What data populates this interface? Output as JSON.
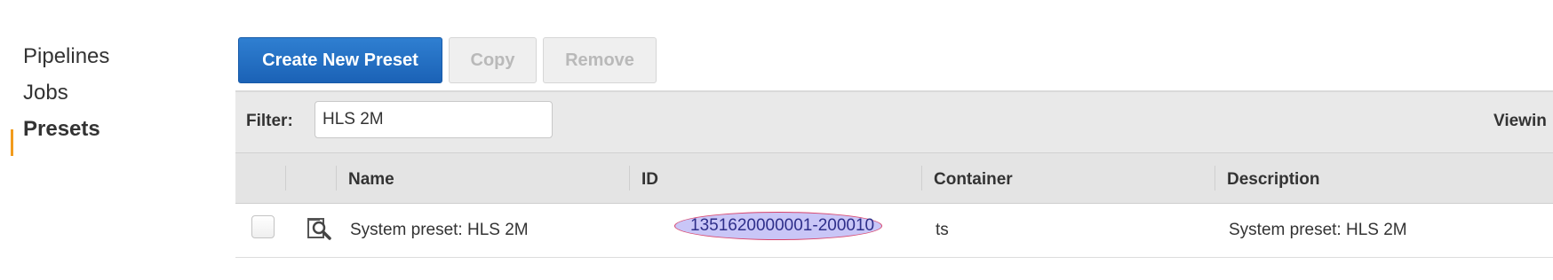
{
  "sidebar": {
    "items": [
      {
        "label": "Pipelines",
        "active": false
      },
      {
        "label": "Jobs",
        "active": false
      },
      {
        "label": "Presets",
        "active": true
      }
    ],
    "accent_color": "#f29b1d"
  },
  "toolbar": {
    "create_label": "Create New Preset",
    "copy_label": "Copy",
    "remove_label": "Remove",
    "primary_color": "#1b62b6"
  },
  "filter": {
    "label": "Filter:",
    "value": "HLS 2M",
    "viewing_text": "Viewin"
  },
  "table": {
    "columns": [
      "Name",
      "ID",
      "Container",
      "Description"
    ],
    "rows": [
      {
        "name": "System preset: HLS 2M",
        "id": "1351620000001-200010",
        "container": "ts",
        "description": "System preset: HLS 2M"
      }
    ],
    "icons": {
      "preview": "magnifier-preview-icon"
    }
  }
}
